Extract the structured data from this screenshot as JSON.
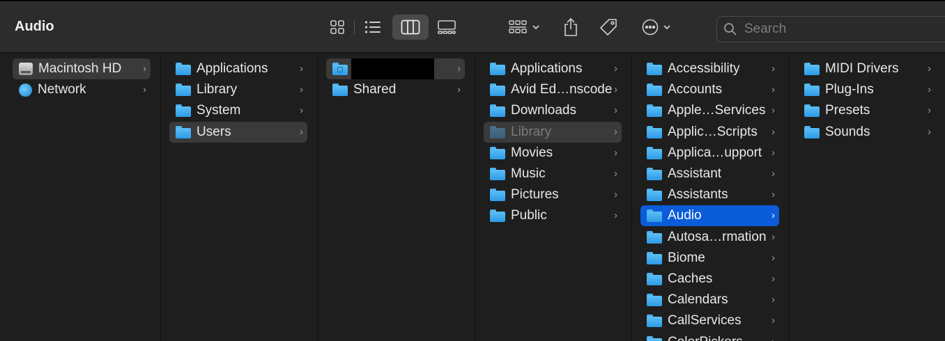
{
  "window": {
    "title": "Audio",
    "search_placeholder": "Search"
  },
  "toolbar": {
    "icons": [
      "icon-view-icon",
      "list-view-icon",
      "column-view-icon",
      "gallery-view-icon",
      "group-by-icon",
      "chevron-down-icon",
      "share-icon",
      "tag-icon",
      "more-icon",
      "chevron-down-icon"
    ]
  },
  "columns": [
    {
      "items": [
        {
          "label": "Macintosh HD",
          "icon": "hard-drive-icon",
          "selected": "gray"
        },
        {
          "label": "Network",
          "icon": "globe-icon"
        }
      ]
    },
    {
      "items": [
        {
          "label": "Applications",
          "icon": "folder-icon"
        },
        {
          "label": "Library",
          "icon": "folder-icon"
        },
        {
          "label": "System",
          "icon": "folder-icon"
        },
        {
          "label": "Users",
          "icon": "folder-icon",
          "selected": "gray"
        }
      ]
    },
    {
      "items": [
        {
          "label": "",
          "icon": "home-folder-icon",
          "selected": "gray",
          "redacted": true
        },
        {
          "label": "Shared",
          "icon": "folder-icon"
        }
      ]
    },
    {
      "items": [
        {
          "label": "Applications",
          "icon": "folder-icon"
        },
        {
          "label": "Avid Ed…nscode",
          "icon": "folder-icon"
        },
        {
          "label": "Downloads",
          "icon": "folder-icon"
        },
        {
          "label": "Library",
          "icon": "folder-icon",
          "selected": "gray",
          "dimmed": true
        },
        {
          "label": "Movies",
          "icon": "folder-icon"
        },
        {
          "label": "Music",
          "icon": "folder-icon"
        },
        {
          "label": "Pictures",
          "icon": "folder-icon"
        },
        {
          "label": "Public",
          "icon": "folder-icon"
        }
      ]
    },
    {
      "items": [
        {
          "label": "Accessibility",
          "icon": "folder-icon"
        },
        {
          "label": "Accounts",
          "icon": "folder-icon"
        },
        {
          "label": "Apple…Services",
          "icon": "folder-icon"
        },
        {
          "label": "Applic…Scripts",
          "icon": "folder-icon"
        },
        {
          "label": "Applica…upport",
          "icon": "folder-icon"
        },
        {
          "label": "Assistant",
          "icon": "folder-icon"
        },
        {
          "label": "Assistants",
          "icon": "folder-icon"
        },
        {
          "label": "Audio",
          "icon": "folder-icon",
          "selected": "blue"
        },
        {
          "label": "Autosa…rmation",
          "icon": "folder-icon"
        },
        {
          "label": "Biome",
          "icon": "folder-icon"
        },
        {
          "label": "Caches",
          "icon": "folder-icon"
        },
        {
          "label": "Calendars",
          "icon": "folder-icon"
        },
        {
          "label": "CallServices",
          "icon": "folder-icon"
        },
        {
          "label": "ColorPickers",
          "icon": "folder-icon"
        }
      ]
    },
    {
      "items": [
        {
          "label": "MIDI Drivers",
          "icon": "folder-icon"
        },
        {
          "label": "Plug-Ins",
          "icon": "folder-icon"
        },
        {
          "label": "Presets",
          "icon": "folder-icon"
        },
        {
          "label": "Sounds",
          "icon": "folder-icon"
        }
      ]
    }
  ],
  "colors": {
    "selection_blue": "#0a5cd8",
    "selection_gray": "#3a3a3a",
    "folder_blue": "#4fb3f0"
  }
}
